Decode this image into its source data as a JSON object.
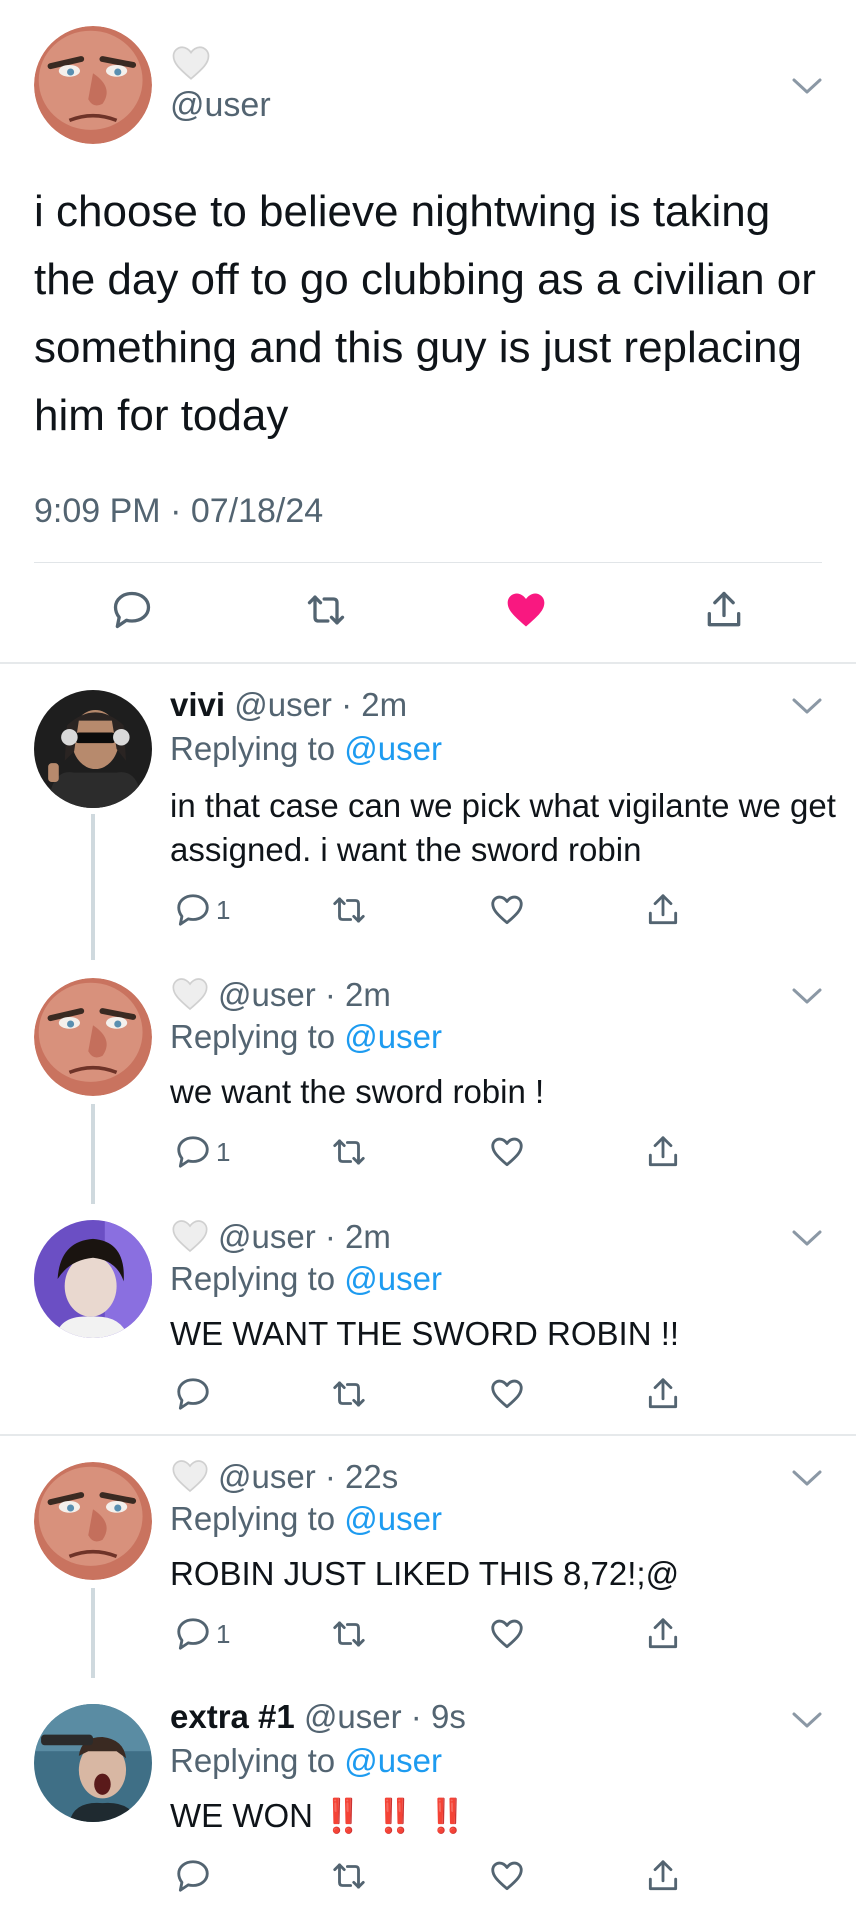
{
  "main_tweet": {
    "handle": "@user",
    "text": "i choose to believe nightwing is taking the day off to go clubbing as a civilian or something and this guy is just replacing him for today",
    "timestamp": "9:09 PM · 07/18/24",
    "liked": true
  },
  "replies": [
    {
      "name": "vivi",
      "handle": "@user",
      "time": "2m",
      "replying_label": "Replying to",
      "replying_to": "@user",
      "text": "in that case can we pick what vigilante we get assigned. i want the sword robin",
      "reply_count": "1",
      "has_heart_badge": false
    },
    {
      "name": "",
      "handle": "@user",
      "time": "2m",
      "replying_label": "Replying to",
      "replying_to": "@user",
      "text": "we want the sword robin !",
      "reply_count": "1",
      "has_heart_badge": true
    },
    {
      "name": "",
      "handle": "@user",
      "time": "2m",
      "replying_label": "Replying to",
      "replying_to": "@user",
      "text": "WE WANT THE SWORD ROBIN !!",
      "reply_count": "",
      "has_heart_badge": true
    },
    {
      "name": "",
      "handle": "@user",
      "time": "22s",
      "replying_label": "Replying to",
      "replying_to": "@user",
      "text": "ROBIN JUST LIKED THIS 8,72!;@",
      "reply_count": "1",
      "has_heart_badge": true
    },
    {
      "name": "extra #1",
      "handle": "@user",
      "time": "9s",
      "replying_label": "Replying to",
      "replying_to": "@user",
      "text": "WE WON",
      "emphasis": "‼️ ‼️ ‼️",
      "reply_count": "",
      "has_heart_badge": false
    }
  ],
  "colors": {
    "like_active": "#f91880",
    "mention": "#1d9bf0",
    "secondary_text": "#536471",
    "thread_line": "#cfd9de"
  }
}
